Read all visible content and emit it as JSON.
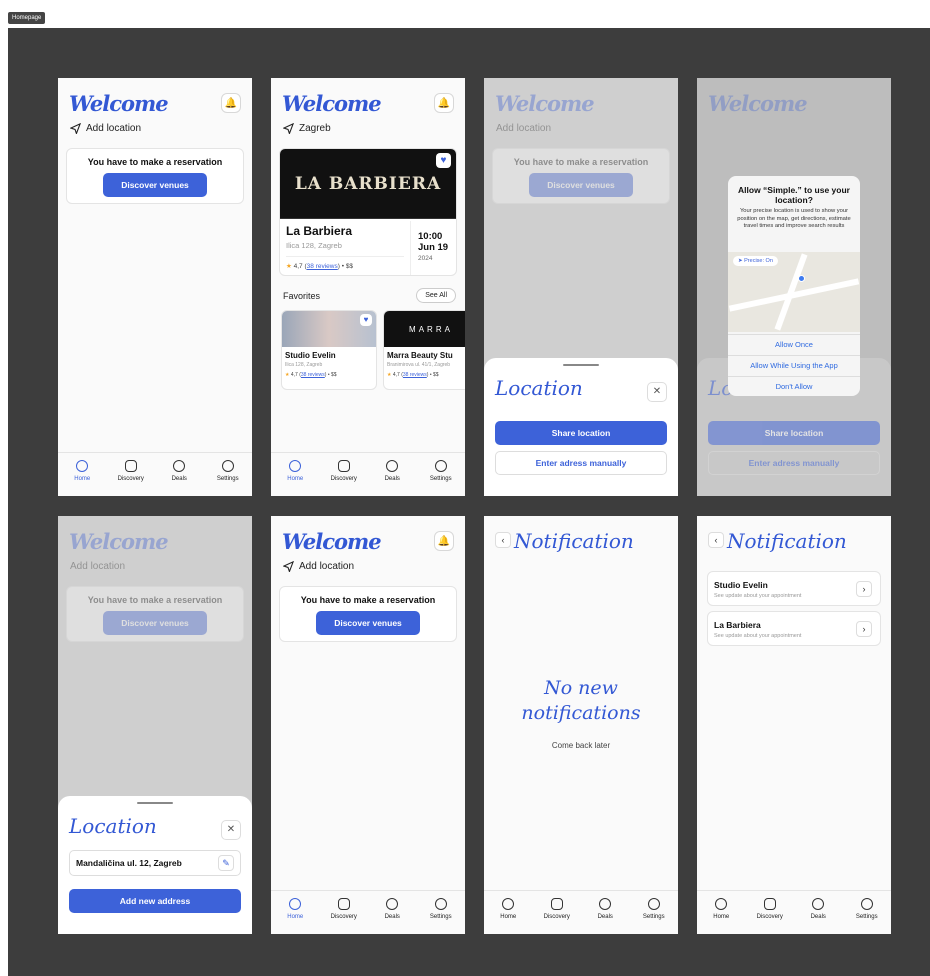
{
  "frame_label": "Homepage",
  "welcome": "Welcome",
  "add_location": "Add location",
  "zagreb": "Zagreb",
  "reservation_text": "You have to make a reservation",
  "discover_btn": "Discover venues",
  "tabs": [
    "Home",
    "Discovery",
    "Deals",
    "Settings"
  ],
  "booking": {
    "venue": "La Barbiera",
    "address": "Ilica 128, Zagreb",
    "rating": "4,7",
    "reviews": "38 reviews",
    "price": "• $$",
    "time": "10:00",
    "date": "Jun 19",
    "year": "2024",
    "logo_text": "LA BARBIERA"
  },
  "favorites": {
    "title": "Favorites",
    "see_all": "See All",
    "items": [
      {
        "name": "Studio Evelin",
        "address": "Ilica 128, Zagreb",
        "rating": "4,7",
        "reviews": "38 reviews",
        "price": "• $$"
      },
      {
        "name": "Marra Beauty Stu",
        "address": "Branimirova ul. 41/1, Zagreb",
        "rating": "4,7",
        "reviews": "38 reviews",
        "price": "• $$",
        "logo": "MARRA"
      }
    ]
  },
  "location_sheet": {
    "title": "Location",
    "share": "Share location",
    "manual": "Enter adress manually",
    "saved_address": "Mandaličina ul. 12, Zagreb",
    "add_new": "Add new address"
  },
  "permission": {
    "title": "Allow “Simple.” to use your location?",
    "body": "Your precise location is used to show your position on the map, get directions, estimate travel times and improve search results",
    "precise": "Precise: On",
    "allow_once": "Allow Once",
    "allow_while": "Allow While Using the App",
    "dont_allow": "Don't Allow"
  },
  "notifications": {
    "title": "Notification",
    "empty_title": "No new notifications",
    "empty_sub": "Come back later",
    "items": [
      {
        "name": "Studio Evelin",
        "sub": "See update about your appointment"
      },
      {
        "name": "La Barbiera",
        "sub": "See update about your appointment"
      }
    ]
  },
  "colors": {
    "accent": "#3d62d9",
    "background": "#3d3d3d"
  }
}
